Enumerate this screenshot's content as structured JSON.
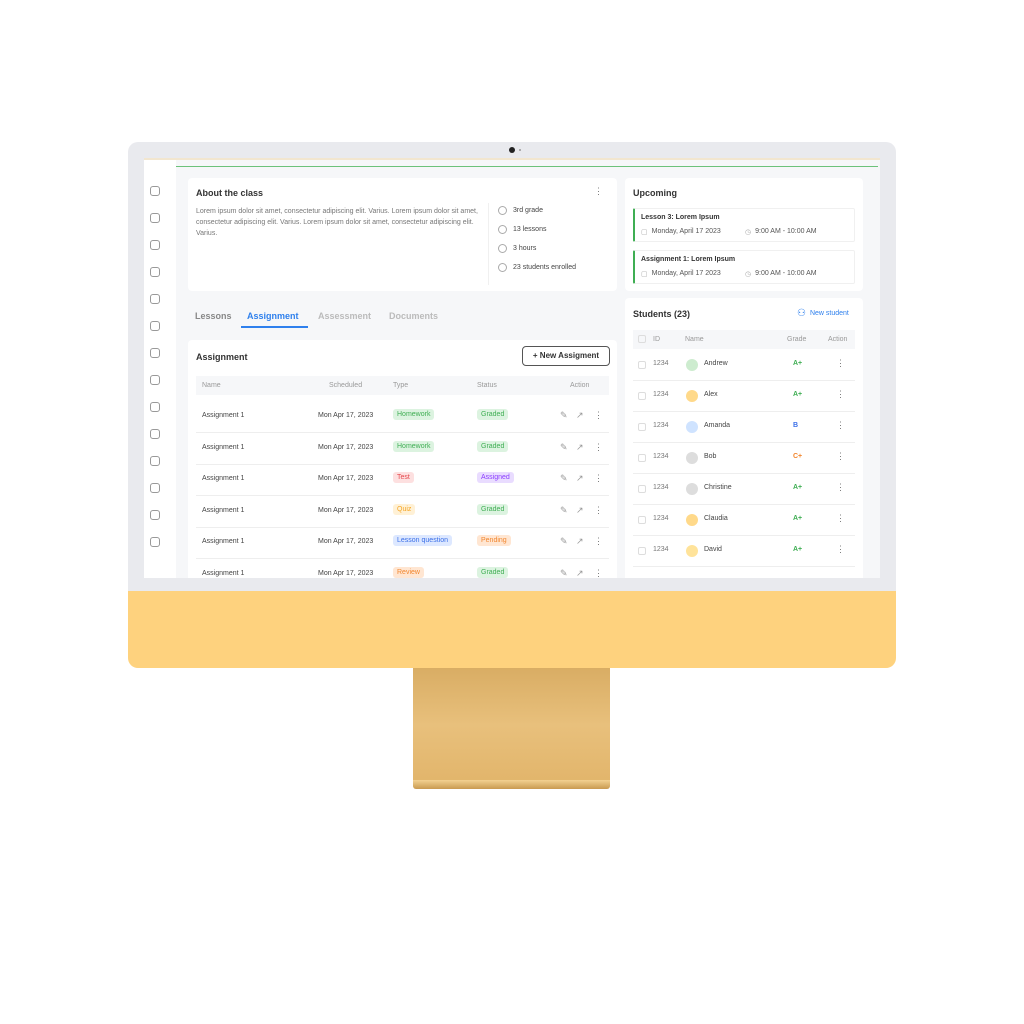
{
  "about": {
    "title": "About the class",
    "text": "Lorem ipsum dolor sit amet, consectetur adipiscing elit. Varius. Lorem ipsum dolor sit amet, consectetur adipiscing elit. Varius. Lorem ipsum dolor sit amet, consectetur adipiscing elit. Varius.",
    "meta": [
      {
        "icon": "graduation-cap-icon",
        "text": "3rd grade"
      },
      {
        "icon": "book-icon",
        "text": "13 lessons"
      },
      {
        "icon": "clock-icon",
        "text": "3 hours"
      },
      {
        "icon": "user-icon",
        "text": "23 students enrolled"
      }
    ]
  },
  "tabs": [
    {
      "label": "Lessons"
    },
    {
      "label": "Assignment"
    },
    {
      "label": "Assessment"
    },
    {
      "label": "Documents"
    }
  ],
  "active_tab": "Assignment",
  "assignment": {
    "title": "Assignment",
    "new_button": "+ New Assigment",
    "columns": [
      "Name",
      "Scheduled",
      "Type",
      "Status",
      "Action"
    ],
    "rows": [
      {
        "name": "Assignment 1",
        "scheduled": "Mon Apr 17, 2023",
        "type": "Homework",
        "status": "Graded"
      },
      {
        "name": "Assignment 1",
        "scheduled": "Mon Apr 17, 2023",
        "type": "Homework",
        "status": "Graded"
      },
      {
        "name": "Assignment 1",
        "scheduled": "Mon Apr 17, 2023",
        "type": "Test",
        "status": "Assigned"
      },
      {
        "name": "Assignment 1",
        "scheduled": "Mon Apr 17, 2023",
        "type": "Quiz",
        "status": "Graded"
      },
      {
        "name": "Assignment 1",
        "scheduled": "Mon Apr 17, 2023",
        "type": "Lesson question",
        "status": "Pending"
      },
      {
        "name": "Assignment 1",
        "scheduled": "Mon Apr 17, 2023",
        "type": "Review",
        "status": "Graded"
      }
    ]
  },
  "pill_colors": {
    "Homework": [
      "#dcf3e0",
      "#3fae53"
    ],
    "Graded": [
      "#dcf3e0",
      "#3fae53"
    ],
    "Test": [
      "#fde0e0",
      "#e5484d"
    ],
    "Assigned": [
      "#e9dcff",
      "#8b3dff"
    ],
    "Quiz": [
      "#fff1d6",
      "#f5a524"
    ],
    "Lesson question": [
      "#dde8ff",
      "#3b6fe8"
    ],
    "Pending": [
      "#ffe6d2",
      "#f2862e"
    ],
    "Review": [
      "#ffe6d2",
      "#f2862e"
    ]
  },
  "upcoming": {
    "title": "Upcoming",
    "events": [
      {
        "title": "Lesson 3: Lorem Ipsum",
        "date": "Monday, April 17 2023",
        "time": "9:00 AM - 10:00 AM"
      },
      {
        "title": "Assignment 1: Lorem Ipsum",
        "date": "Monday, April 17 2023",
        "time": "9:00 AM - 10:00 AM"
      }
    ]
  },
  "students": {
    "title": "Students (23)",
    "new_button": "New student",
    "columns": [
      "ID",
      "Name",
      "Grade",
      "Action"
    ],
    "rows": [
      {
        "id": "1234",
        "name": "Andrew",
        "grade": "A+",
        "avatar": "#cdeccf"
      },
      {
        "id": "1234",
        "name": "Alex",
        "grade": "A+",
        "avatar": "#ffd98a"
      },
      {
        "id": "1234",
        "name": "Amanda",
        "grade": "B",
        "avatar": "#cfe3ff"
      },
      {
        "id": "1234",
        "name": "Bob",
        "grade": "C+",
        "avatar": "#ddd"
      },
      {
        "id": "1234",
        "name": "Christine",
        "grade": "A+",
        "avatar": "#ddd"
      },
      {
        "id": "1234",
        "name": "Claudia",
        "grade": "A+",
        "avatar": "#ffd98a"
      },
      {
        "id": "1234",
        "name": "David",
        "grade": "A+",
        "avatar": "#ffe39a"
      }
    ]
  },
  "grade_colors": {
    "A+": "#3fae53",
    "B": "#3b6fe8",
    "C+": "#f2862e"
  },
  "colors": {
    "accent": "#2f80ed",
    "chin": "#fed27e",
    "stand": "#e2b56b"
  },
  "sidebar_icons": [
    "chart-icon",
    "layout-icon",
    "heart-icon",
    "chat-icon",
    "briefcase-icon",
    "message-icon",
    "user-card-icon",
    "clipboard-icon",
    "calendar-icon",
    "smile-icon",
    "graduation-icon",
    "edit-icon",
    "notebook-icon",
    "trash-icon"
  ]
}
